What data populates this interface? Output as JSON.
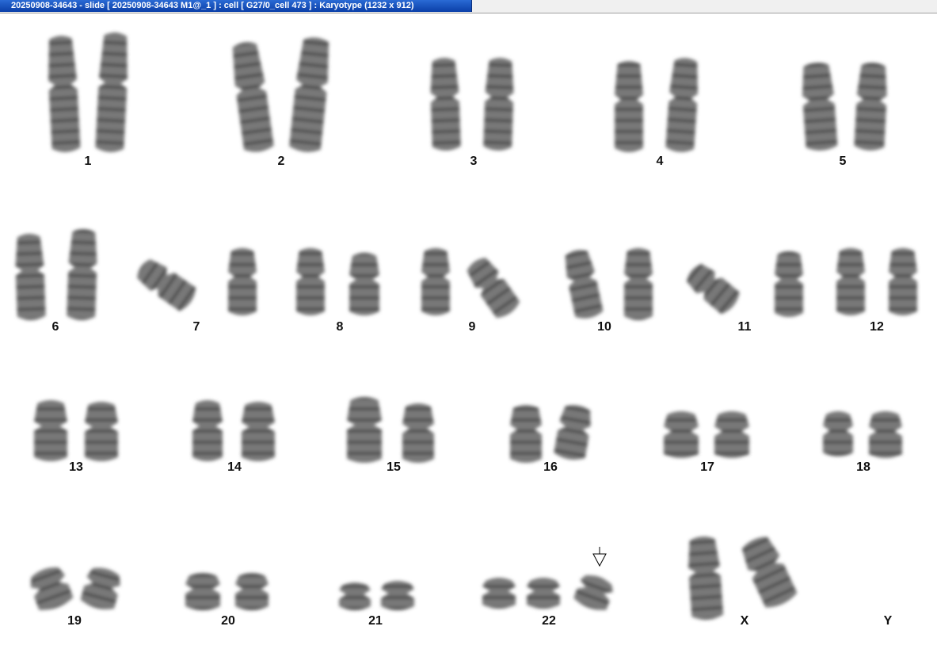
{
  "window": {
    "title": "20250908-34643 - slide [ 20250908-34643 M1@_1 ] : cell [ G27/0_cell 473 ] : Karyotype  (1232 x 912)"
  },
  "karyotype": {
    "labels": {
      "c1": "1",
      "c2": "2",
      "c3": "3",
      "c4": "4",
      "c5": "5",
      "c6": "6",
      "c7": "7",
      "c8": "8",
      "c9": "9",
      "c10": "10",
      "c11": "11",
      "c12": "12",
      "c13": "13",
      "c14": "14",
      "c15": "15",
      "c16": "16",
      "c17": "17",
      "c18": "18",
      "c19": "19",
      "c20": "20",
      "c21": "21",
      "c22": "22",
      "cX": "X",
      "cY": "Y"
    },
    "extra_copy_marker": "arrow-down-icon",
    "colors": {
      "chromosome": "#5a5a5a",
      "label": "#111111",
      "titlebar": "#0a3fa8"
    }
  }
}
